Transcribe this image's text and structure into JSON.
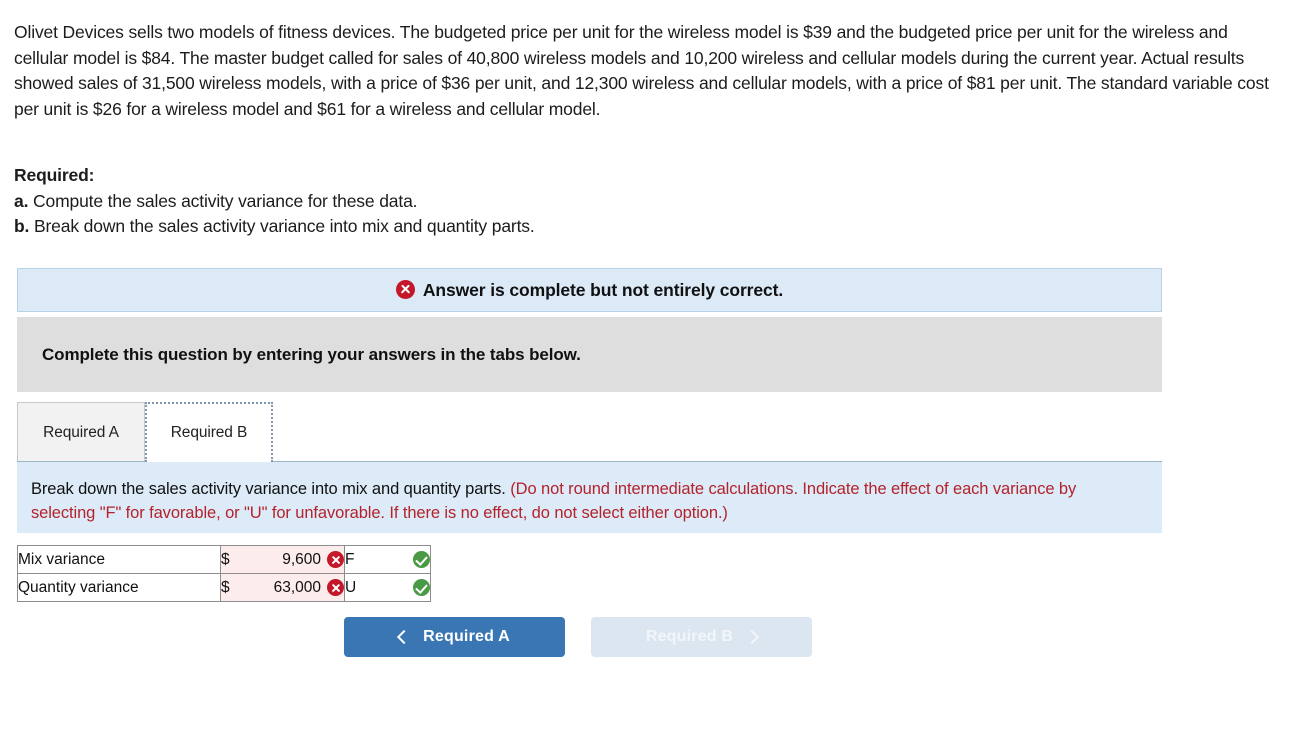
{
  "problem": {
    "stem": "Olivet Devices sells two models of fitness devices. The budgeted price per unit for the wireless model is $39 and the budgeted price per unit for the wireless and cellular model is $84. The master budget called for sales of 40,800 wireless models and 10,200 wireless and cellular models during the current year. Actual results showed sales of 31,500 wireless models, with a price of $36 per unit, and 12,300 wireless and cellular models, with a price of $81 per unit. The standard variable cost per unit is $26 for a wireless model and $61 for a wireless and cellular model.",
    "required_title": "Required:",
    "requirements": [
      {
        "letter": "a.",
        "text": "Compute the sales activity variance for these data."
      },
      {
        "letter": "b.",
        "text": "Break down the sales activity variance into mix and quantity parts."
      }
    ]
  },
  "status_banner": {
    "icon": "x-circle-icon",
    "text": "Answer is complete but not entirely correct.",
    "background_color": "#dce9f6",
    "icon_color": "#c2182a"
  },
  "instruction_bar": {
    "text": "Complete this question by entering your answers in the tabs below.",
    "background_color": "#dedede"
  },
  "tabs": [
    {
      "label": "Required A",
      "active": false
    },
    {
      "label": "Required B",
      "active": true
    }
  ],
  "sub_panel": {
    "main_text": "Break down the sales activity variance into mix and quantity parts. ",
    "hint_text": "(Do not round intermediate calculations. Indicate the effect of each variance by selecting \"F\" for favorable, or \"U\" for unfavorable. If there is no effect, do not select either option.)",
    "hint_color": "#b4222c",
    "background_color": "#dcebf7"
  },
  "answer_table": {
    "rows": [
      {
        "label": "Mix variance",
        "currency": "$",
        "amount": "9,600",
        "amount_mark": "wrong-icon",
        "effect": "F",
        "effect_mark": "correct-icon"
      },
      {
        "label": "Quantity variance",
        "currency": "$",
        "amount": "63,000",
        "amount_mark": "wrong-icon",
        "effect": "U",
        "effect_mark": "correct-icon"
      }
    ],
    "wrong_cell_background": "#fcecec",
    "wrong_icon_color": "#c2182a",
    "correct_icon_color": "#4a9a45"
  },
  "nav_buttons": {
    "prev": {
      "label": "Required A",
      "icon": "chevron-left-icon",
      "enabled": true,
      "color": "#3b76b4"
    },
    "next": {
      "label": "Required B",
      "icon": "chevron-right-icon",
      "enabled": false,
      "color": "#dce6f1"
    }
  }
}
